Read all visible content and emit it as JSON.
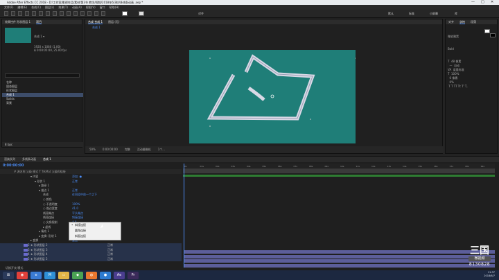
{
  "window": {
    "title": "Adobe After Effects CC 2018 - D:\\工作室/影视作品/素材/第3节 教学/视频/2018年6/3秒/多线条动画 .aep *",
    "minimize": "—",
    "maximize": "□",
    "close": "✕"
  },
  "menu": [
    "文件(F)",
    "编辑(E)",
    "合成(C)",
    "图层(L)",
    "效果(T)",
    "动画(A)",
    "视图(V)",
    "窗口",
    "帮助(H)"
  ],
  "toolbar": {
    "snap_label": "对齐",
    "workspace": [
      "默认",
      "标准",
      "小屏幕",
      "库"
    ]
  },
  "project": {
    "tab": "项目",
    "tab2": "效果控件 形状图层 1",
    "comp_name": "合成 1 ▾",
    "info": "1920 x 1080 (1.00)\nΔ 0:00:05:00, 25.00 fps",
    "items": [
      "名称",
      "固态图层",
      "形状图层",
      "合成 1",
      "Solids",
      "背景"
    ],
    "footer": "8 bpc"
  },
  "viewer": {
    "tab": "合成 合成 1",
    "tab2": "图层 (无)",
    "breadcrumb": "合成 1",
    "zoom": "50%",
    "time": "0:00:00:00",
    "res": "完整",
    "camera": "活动摄像机",
    "views": "1个..."
  },
  "right_panel": {
    "tab": "对齐",
    "tab2": "字符",
    "tab3": "段落",
    "font": "微软雅黑",
    "style": "Bold",
    "content": "T  48 像素\n  —  自动\nVA  度量标准\nT  100%\n  0 像素\n  0%\n T T TT Tt T' T,"
  },
  "timeline": {
    "tabs": [
      "渲染队列",
      "多线条动画",
      "合成 1"
    ],
    "timecode": "0:00:00:00",
    "header": "#  源名称          父级          模式     T  TrkMat  父级和链接",
    "rows": [
      {
        "indent": 44,
        "name": "▾ 内容",
        "value": "添加: ●",
        "mode": ""
      },
      {
        "indent": 50,
        "name": "▾ 形状 1",
        "value": "正常",
        "mode": ""
      },
      {
        "indent": 56,
        "name": "▸ 路径 1",
        "value": "",
        "mode": ""
      },
      {
        "indent": 56,
        "name": "▾ 描边 1",
        "value": "正常",
        "mode": ""
      },
      {
        "indent": 62,
        "name": "合成",
        "value": "在同组中前一个之下",
        "mode": ""
      },
      {
        "indent": 62,
        "name": "○ 颜色",
        "value": "",
        "mode": ""
      },
      {
        "indent": 62,
        "name": "○ 不透明度",
        "value": "100%",
        "mode": ""
      },
      {
        "indent": 62,
        "name": "○ 描边宽度",
        "value": "41.0",
        "mode": ""
      },
      {
        "indent": 62,
        "name": "线段端点",
        "value": "平头端点",
        "mode": ""
      },
      {
        "indent": 62,
        "name": "线段连接",
        "value": "斜接连接",
        "mode": ""
      },
      {
        "indent": 62,
        "name": "○ 尖角限制",
        "value": "4.0",
        "mode": ""
      },
      {
        "indent": 62,
        "name": "▸ 虚线",
        "value": "",
        "mode": ""
      },
      {
        "indent": 56,
        "name": "▸ 填充 1",
        "value": "正常",
        "mode": ""
      },
      {
        "indent": 56,
        "name": "▸ 变换: 形状 1",
        "value": "",
        "mode": ""
      },
      {
        "indent": 44,
        "name": "▸ 变换",
        "value": "重置",
        "mode": ""
      },
      {
        "indent": 40,
        "name": "2  ★ 形状图层 2",
        "value": "",
        "mode": "正常"
      },
      {
        "indent": 40,
        "name": "3  ★ 形状图层 3",
        "value": "",
        "mode": "正常"
      },
      {
        "indent": 40,
        "name": "4  ★ 形状图层 4",
        "value": "",
        "mode": "正常"
      },
      {
        "indent": 40,
        "name": "5  ★ 形状图层 5",
        "value": "",
        "mode": "正常"
      }
    ],
    "ruler": [
      "0s",
      "01s",
      "02s",
      "03s",
      "04s",
      "05s",
      "06s",
      "07s",
      "08s",
      "09s",
      "10s",
      "11s",
      "12s",
      "13s",
      "14s",
      "15s",
      "16s",
      "17s",
      "18s",
      "19s"
    ],
    "footer": "切换开关/模式"
  },
  "dropdown": {
    "options": [
      "斜接连接",
      "圆角连接",
      "斜面连接"
    ],
    "selected_index": 0,
    "check": "•"
  },
  "watermark": {
    "big": "三国",
    "box": "微视频",
    "num": "8130828"
  },
  "taskbar": {
    "icons": [
      "start-icon",
      "weibo-icon",
      "browser-icon",
      "mail-icon",
      "folder-icon",
      "maps-icon",
      "firefox-icon",
      "app-icon",
      "ae-icon",
      "premiere-icon"
    ],
    "clock_time": "11:37",
    "clock_date": "2018/6/7"
  },
  "colors": {
    "canvas": "#1f7e78",
    "accent": "#4b8cf5",
    "track": "#5c5e9a",
    "shape": "#d9d9e6"
  }
}
